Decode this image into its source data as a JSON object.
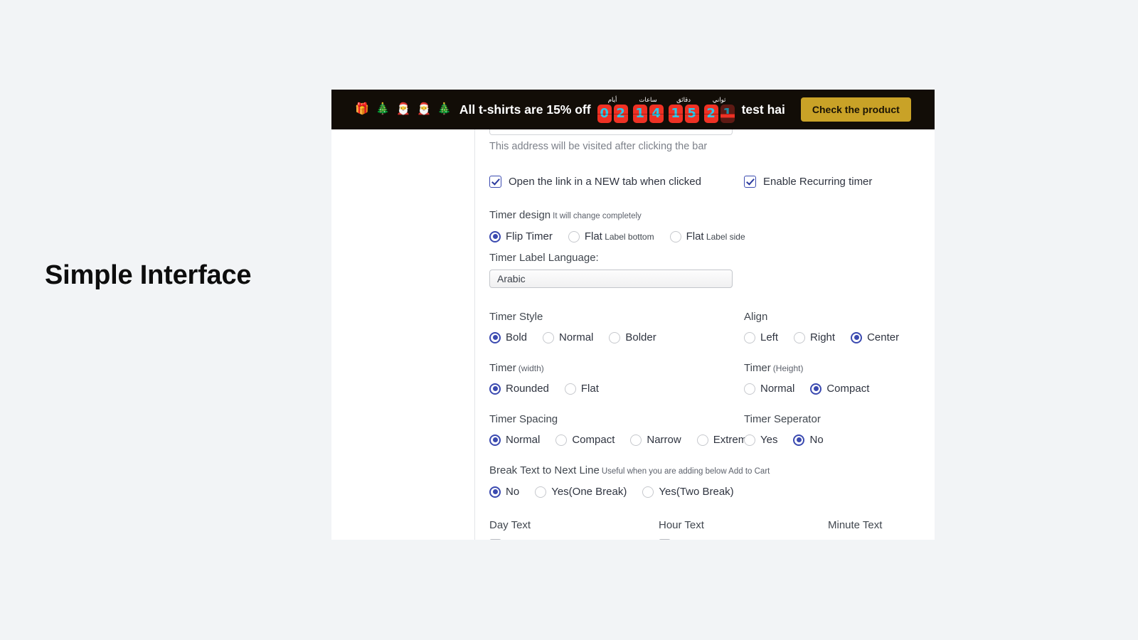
{
  "headline": "Simple Interface",
  "announcement_bar": {
    "emojis": [
      "🎁",
      "🎄",
      "🎅",
      "🎅",
      "🎄"
    ],
    "emoji_names": [
      "gift-emoji",
      "christmas-tree-emoji",
      "santa-emoji",
      "santa-emoji",
      "christmas-tree-emoji"
    ],
    "message": "All t-shirts are 15% off",
    "suffix_text": "test hai",
    "cta_label": "Check the product",
    "background_color": "#120d07",
    "cta_color": "#c9a227",
    "digit_background": "#ef3124",
    "digit_color": "#2cc8e8",
    "timer": [
      {
        "label": "أيام",
        "label_en": "days",
        "digits": [
          "0",
          "2"
        ],
        "flipping": [
          false,
          false
        ]
      },
      {
        "label": "ساعات",
        "label_en": "hours",
        "digits": [
          "1",
          "4"
        ],
        "flipping": [
          false,
          false
        ]
      },
      {
        "label": "دقائق",
        "label_en": "minutes",
        "digits": [
          "1",
          "5"
        ],
        "flipping": [
          false,
          false
        ]
      },
      {
        "label": "ثواني",
        "label_en": "seconds",
        "digits": [
          "2",
          "1"
        ],
        "flipping": [
          false,
          true
        ]
      }
    ]
  },
  "form": {
    "url_helper": "This address will be visited after clicking the bar",
    "new_tab_checkbox": {
      "label": "Open the link in a NEW tab when clicked",
      "checked": true
    },
    "recurring_checkbox": {
      "label": "Enable Recurring timer",
      "checked": true
    },
    "timer_design": {
      "label": "Timer design",
      "hint": "It will change completely",
      "options": [
        {
          "label": "Flip Timer",
          "sub": "",
          "selected": true
        },
        {
          "label": "Flat",
          "sub": "Label bottom",
          "selected": false
        },
        {
          "label": "Flat",
          "sub": "Label side",
          "selected": false
        }
      ]
    },
    "language": {
      "label": "Timer Label Language:",
      "value": "Arabic"
    },
    "timer_style": {
      "label": "Timer Style",
      "options": [
        {
          "label": "Bold",
          "selected": true
        },
        {
          "label": "Normal",
          "selected": false
        },
        {
          "label": "Bolder",
          "selected": false
        }
      ]
    },
    "align": {
      "label": "Align",
      "options": [
        {
          "label": "Left",
          "selected": false
        },
        {
          "label": "Right",
          "selected": false
        },
        {
          "label": "Center",
          "selected": true
        }
      ]
    },
    "timer_width": {
      "label": "Timer",
      "hint": "(width)",
      "options": [
        {
          "label": "Rounded",
          "selected": true
        },
        {
          "label": "Flat",
          "selected": false
        }
      ]
    },
    "timer_height": {
      "label": "Timer",
      "hint": "(Height)",
      "options": [
        {
          "label": "Normal",
          "selected": false
        },
        {
          "label": "Compact",
          "selected": true
        }
      ]
    },
    "timer_spacing": {
      "label": "Timer Spacing",
      "options": [
        {
          "label": "Normal",
          "selected": true
        },
        {
          "label": "Compact",
          "selected": false
        },
        {
          "label": "Narrow",
          "selected": false
        },
        {
          "label": "Extreme",
          "selected": false
        }
      ]
    },
    "timer_seperator": {
      "label": "Timer Seperator",
      "options": [
        {
          "label": "Yes",
          "selected": false
        },
        {
          "label": "No",
          "selected": true
        }
      ]
    },
    "break_text": {
      "label": "Break Text to Next Line",
      "hint": "Useful when you are adding below Add to Cart",
      "options": [
        {
          "label": "No",
          "selected": true
        },
        {
          "label": "Yes(One Break)",
          "selected": false
        },
        {
          "label": "Yes(Two Break)",
          "selected": false
        }
      ]
    },
    "bottom_labels": {
      "day_text": "Day Text",
      "hour_text": "Hour Text",
      "minute_text": "Minute Text"
    }
  }
}
